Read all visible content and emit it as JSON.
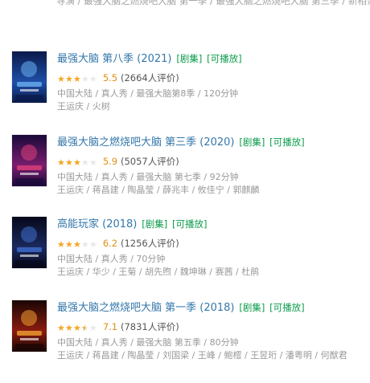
{
  "top_line": "导演 / 最强大脑之燃烧吧大脑 第一季 / 最强大脑之燃烧吧大脑 第三季 / 新相亲时代",
  "items": [
    {
      "title": "最强大脑 第八季 (2021)",
      "tag_series": "[剧集]",
      "tag_playable": "[可播放]",
      "stars": 3,
      "half_star": false,
      "score": "5.5",
      "votes": "(2664人评价)",
      "meta": "中国大陆 / 真人秀 / 最强大脑第8季 / 120分钟",
      "cast": "王运庆 / 火树",
      "poster_colors": [
        "#0a1a4a",
        "#1e4fa8",
        "#6ab0f0"
      ]
    },
    {
      "title": "最强大脑之燃烧吧大脑 第三季 (2020)",
      "tag_series": "[剧集]",
      "tag_playable": "[可播放]",
      "stars": 3,
      "half_star": false,
      "score": "5.9",
      "votes": "(5057人评价)",
      "meta": "中国大陆 / 真人秀 / 最强大脑 第七季 / 92分钟",
      "cast": "王运庆 / 蒋昌建 / 陶晶莹 / 薛兆丰 / 攸佳宁 / 郭麒麟",
      "poster_colors": [
        "#1a0a3a",
        "#7a1d6e",
        "#e0407a"
      ]
    },
    {
      "title": "高能玩家 (2018)",
      "tag_series": "[剧集]",
      "tag_playable": "[可播放]",
      "stars": 3,
      "half_star": false,
      "score": "6.2",
      "votes": "(1256人评价)",
      "meta": "中国大陆 / 真人秀 / 70分钟",
      "cast": "王运庆 / 华少 / 王菊 / 胡先煦 / 魏坤琳 / 赛茜 / 杜鹃",
      "poster_colors": [
        "#06081a",
        "#1b2a5e",
        "#3f6fd0"
      ]
    },
    {
      "title": "最强大脑之燃烧吧大脑 第一季 (2018)",
      "tag_series": "[剧集]",
      "tag_playable": "[可播放]",
      "stars": 3,
      "half_star": true,
      "score": "7.1",
      "votes": "(7831人评价)",
      "meta": "中国大陆 / 真人秀 / 最强大脑 第五季 / 80分钟",
      "cast": "王运庆 / 蒋昌建 / 陶晶莹 / 刘国梁 / 王峰 / 鲍橒 / 王昱珩 / 潘粤明 / 何猷君",
      "poster_colors": [
        "#1a0604",
        "#8a1c10",
        "#f0a030"
      ]
    }
  ]
}
